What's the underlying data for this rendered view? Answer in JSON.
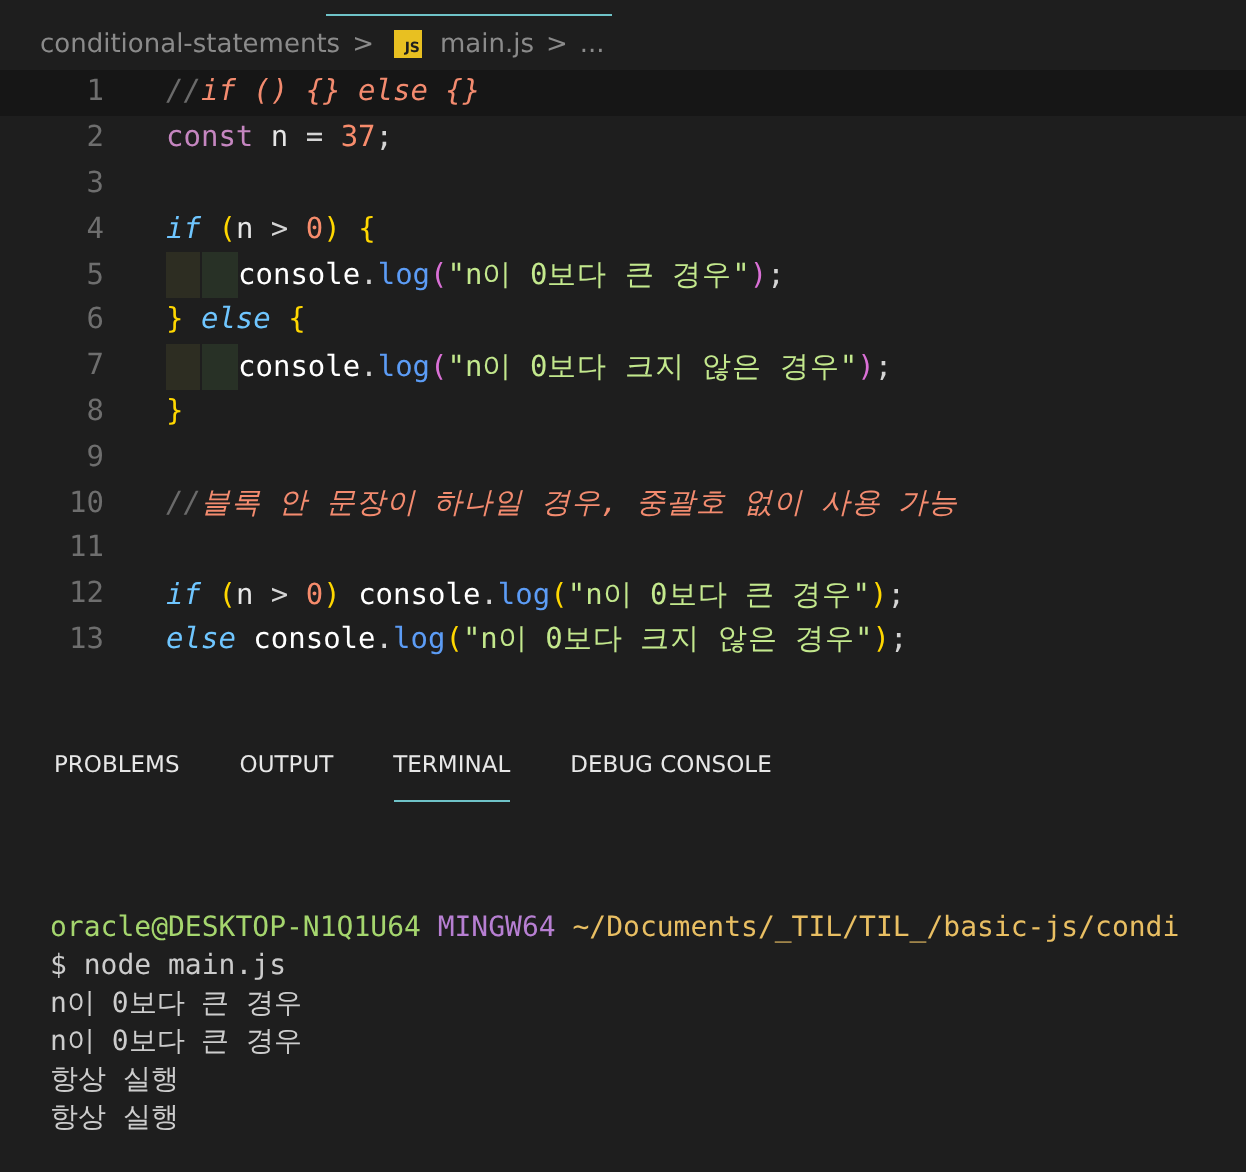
{
  "breadcrumb": {
    "folder": "conditional-statements",
    "separator_1": ">",
    "file_badge": "JS",
    "file": "main.js",
    "separator_2": ">",
    "more": "..."
  },
  "editor": {
    "lines": [
      {
        "number": "1",
        "current": true,
        "indent_guide": false,
        "tokens": [
          {
            "kind": "comment-mark",
            "text": "//"
          },
          {
            "kind": "comment",
            "text": "if () {} else {}"
          }
        ]
      },
      {
        "number": "2",
        "current": false,
        "indent_guide": false,
        "tokens": [
          {
            "kind": "storage",
            "text": "const"
          },
          {
            "kind": "plain",
            "text": " n "
          },
          {
            "kind": "operator",
            "text": "= "
          },
          {
            "kind": "number",
            "text": "37"
          },
          {
            "kind": "operator",
            "text": ";"
          }
        ]
      },
      {
        "number": "3",
        "current": false,
        "indent_guide": false
      },
      {
        "number": "4",
        "current": false,
        "indent_guide": false,
        "tokens": [
          {
            "kind": "control",
            "text": "if "
          },
          {
            "kind": "bracket",
            "text": "("
          },
          {
            "kind": "plain",
            "text": "n "
          },
          {
            "kind": "operator",
            "text": "> "
          },
          {
            "kind": "number",
            "text": "0"
          },
          {
            "kind": "bracket",
            "text": ") {"
          }
        ]
      },
      {
        "number": "5",
        "current": false,
        "indent_guide": true,
        "tokens": [
          {
            "kind": "object",
            "text": "console"
          },
          {
            "kind": "operator",
            "text": "."
          },
          {
            "kind": "function",
            "text": "log"
          },
          {
            "kind": "bracket2",
            "text": "("
          },
          {
            "kind": "string",
            "text": "\"n이 0보다 큰 경우\""
          },
          {
            "kind": "bracket2",
            "text": ")"
          },
          {
            "kind": "operator",
            "text": ";"
          }
        ]
      },
      {
        "number": "6",
        "current": false,
        "indent_guide": false,
        "tokens": [
          {
            "kind": "bracket",
            "text": "} "
          },
          {
            "kind": "control",
            "text": "else "
          },
          {
            "kind": "bracket",
            "text": "{"
          }
        ]
      },
      {
        "number": "7",
        "current": false,
        "indent_guide": true,
        "tokens": [
          {
            "kind": "object",
            "text": "console"
          },
          {
            "kind": "operator",
            "text": "."
          },
          {
            "kind": "function",
            "text": "log"
          },
          {
            "kind": "bracket2",
            "text": "("
          },
          {
            "kind": "string",
            "text": "\"n이 0보다 크지 않은 경우\""
          },
          {
            "kind": "bracket2",
            "text": ")"
          },
          {
            "kind": "operator",
            "text": ";"
          }
        ]
      },
      {
        "number": "8",
        "current": false,
        "indent_guide": false,
        "tokens": [
          {
            "kind": "bracket",
            "text": "}"
          }
        ]
      },
      {
        "number": "9",
        "current": false,
        "indent_guide": false
      },
      {
        "number": "10",
        "current": false,
        "indent_guide": false,
        "tokens": [
          {
            "kind": "comment-mark",
            "text": "//"
          },
          {
            "kind": "comment",
            "text": "블록 안 문장이 하나일 경우, 중괄호 없이 사용 가능"
          }
        ]
      },
      {
        "number": "11",
        "current": false,
        "indent_guide": false
      },
      {
        "number": "12",
        "current": false,
        "indent_guide": false,
        "tokens": [
          {
            "kind": "control",
            "text": "if "
          },
          {
            "kind": "bracket",
            "text": "("
          },
          {
            "kind": "plain",
            "text": "n "
          },
          {
            "kind": "operator",
            "text": "> "
          },
          {
            "kind": "number",
            "text": "0"
          },
          {
            "kind": "bracket",
            "text": ") "
          },
          {
            "kind": "object",
            "text": "console"
          },
          {
            "kind": "operator",
            "text": "."
          },
          {
            "kind": "function",
            "text": "log"
          },
          {
            "kind": "bracket",
            "text": "("
          },
          {
            "kind": "string",
            "text": "\"n이 0보다 큰 경우\""
          },
          {
            "kind": "bracket",
            "text": ")"
          },
          {
            "kind": "operator",
            "text": ";"
          }
        ]
      },
      {
        "number": "13",
        "current": false,
        "indent_guide": false,
        "tokens": [
          {
            "kind": "control",
            "text": "else "
          },
          {
            "kind": "object",
            "text": "console"
          },
          {
            "kind": "operator",
            "text": "."
          },
          {
            "kind": "function",
            "text": "log"
          },
          {
            "kind": "bracket",
            "text": "("
          },
          {
            "kind": "string",
            "text": "\"n이 0보다 크지 않은 경우\""
          },
          {
            "kind": "bracket",
            "text": ")"
          },
          {
            "kind": "operator",
            "text": ";"
          }
        ]
      }
    ]
  },
  "panel": {
    "tabs": [
      {
        "label": "PROBLEMS",
        "selected": false
      },
      {
        "label": "OUTPUT",
        "selected": false
      },
      {
        "label": "TERMINAL",
        "selected": true
      },
      {
        "label": "DEBUG CONSOLE",
        "selected": false
      }
    ]
  },
  "terminal": {
    "prompt": {
      "user_host": "oracle@DESKTOP-N1Q1U64",
      "system": "MINGW64",
      "path": "~/Documents/_TIL/TIL_/basic-js/condi"
    },
    "lines": [
      "$ node main.js",
      "n이 0보다 큰 경우",
      "n이 0보다 큰 경우",
      "항상 실행",
      "항상 실행"
    ]
  }
}
